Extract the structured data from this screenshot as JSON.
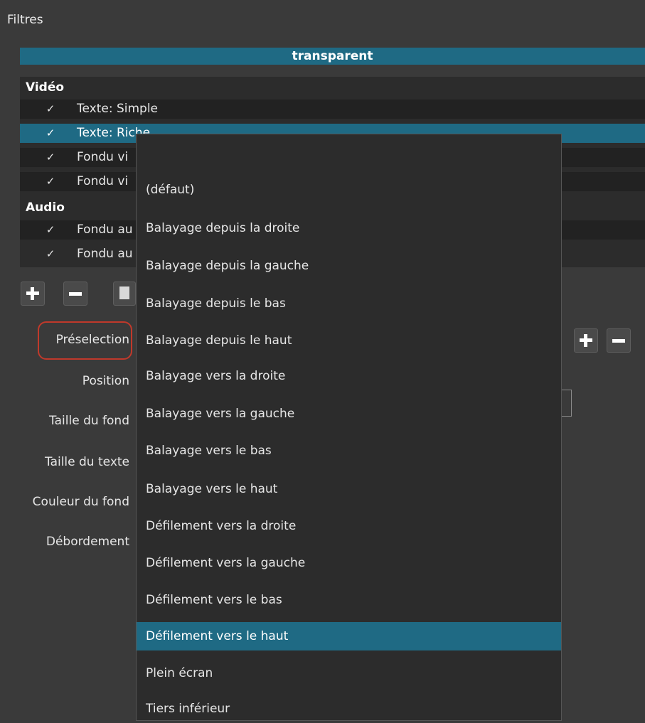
{
  "panel": {
    "title": "Filtres"
  },
  "clip": {
    "name": "transparent"
  },
  "groups": {
    "video": {
      "label": "Vidéo",
      "filters": [
        {
          "check": "✓",
          "name": "Texte: Simple",
          "selected": false
        },
        {
          "check": "✓",
          "name": "Texte: Riche",
          "selected": true
        },
        {
          "check": "✓",
          "name": "Fondu vi",
          "selected": false
        },
        {
          "check": "✓",
          "name": "Fondu vi",
          "selected": false
        }
      ]
    },
    "audio": {
      "label": "Audio",
      "filters": [
        {
          "check": "✓",
          "name": "Fondu au",
          "selected": false
        },
        {
          "check": "✓",
          "name": "Fondu au",
          "selected": false
        }
      ]
    }
  },
  "toolbar": {
    "add_icon": "plus-icon",
    "remove_icon": "minus-icon",
    "copy_icon": "copy-icon"
  },
  "properties": {
    "preset": "Préselection",
    "position": "Position",
    "background_size": "Taille du fond",
    "text_size": "Taille du texte",
    "background_color": "Couleur du fond",
    "overflow": "Débordement"
  },
  "preset_dropdown": {
    "items": [
      "(défaut)",
      "Balayage depuis la droite",
      "Balayage depuis la gauche",
      "Balayage depuis le bas",
      "Balayage depuis le haut",
      "Balayage vers la droite",
      "Balayage vers la gauche",
      "Balayage vers le bas",
      "Balayage vers le haut",
      "Défilement vers la droite",
      "Défilement vers la gauche",
      "Défilement vers le bas",
      "Défilement vers le haut",
      "Plein écran",
      "Tiers inférieur"
    ],
    "highlighted": "Défilement vers le haut"
  },
  "colors": {
    "accent": "#1f6a84",
    "background": "#3a3a3a",
    "highlight_outline": "#c0392b"
  }
}
